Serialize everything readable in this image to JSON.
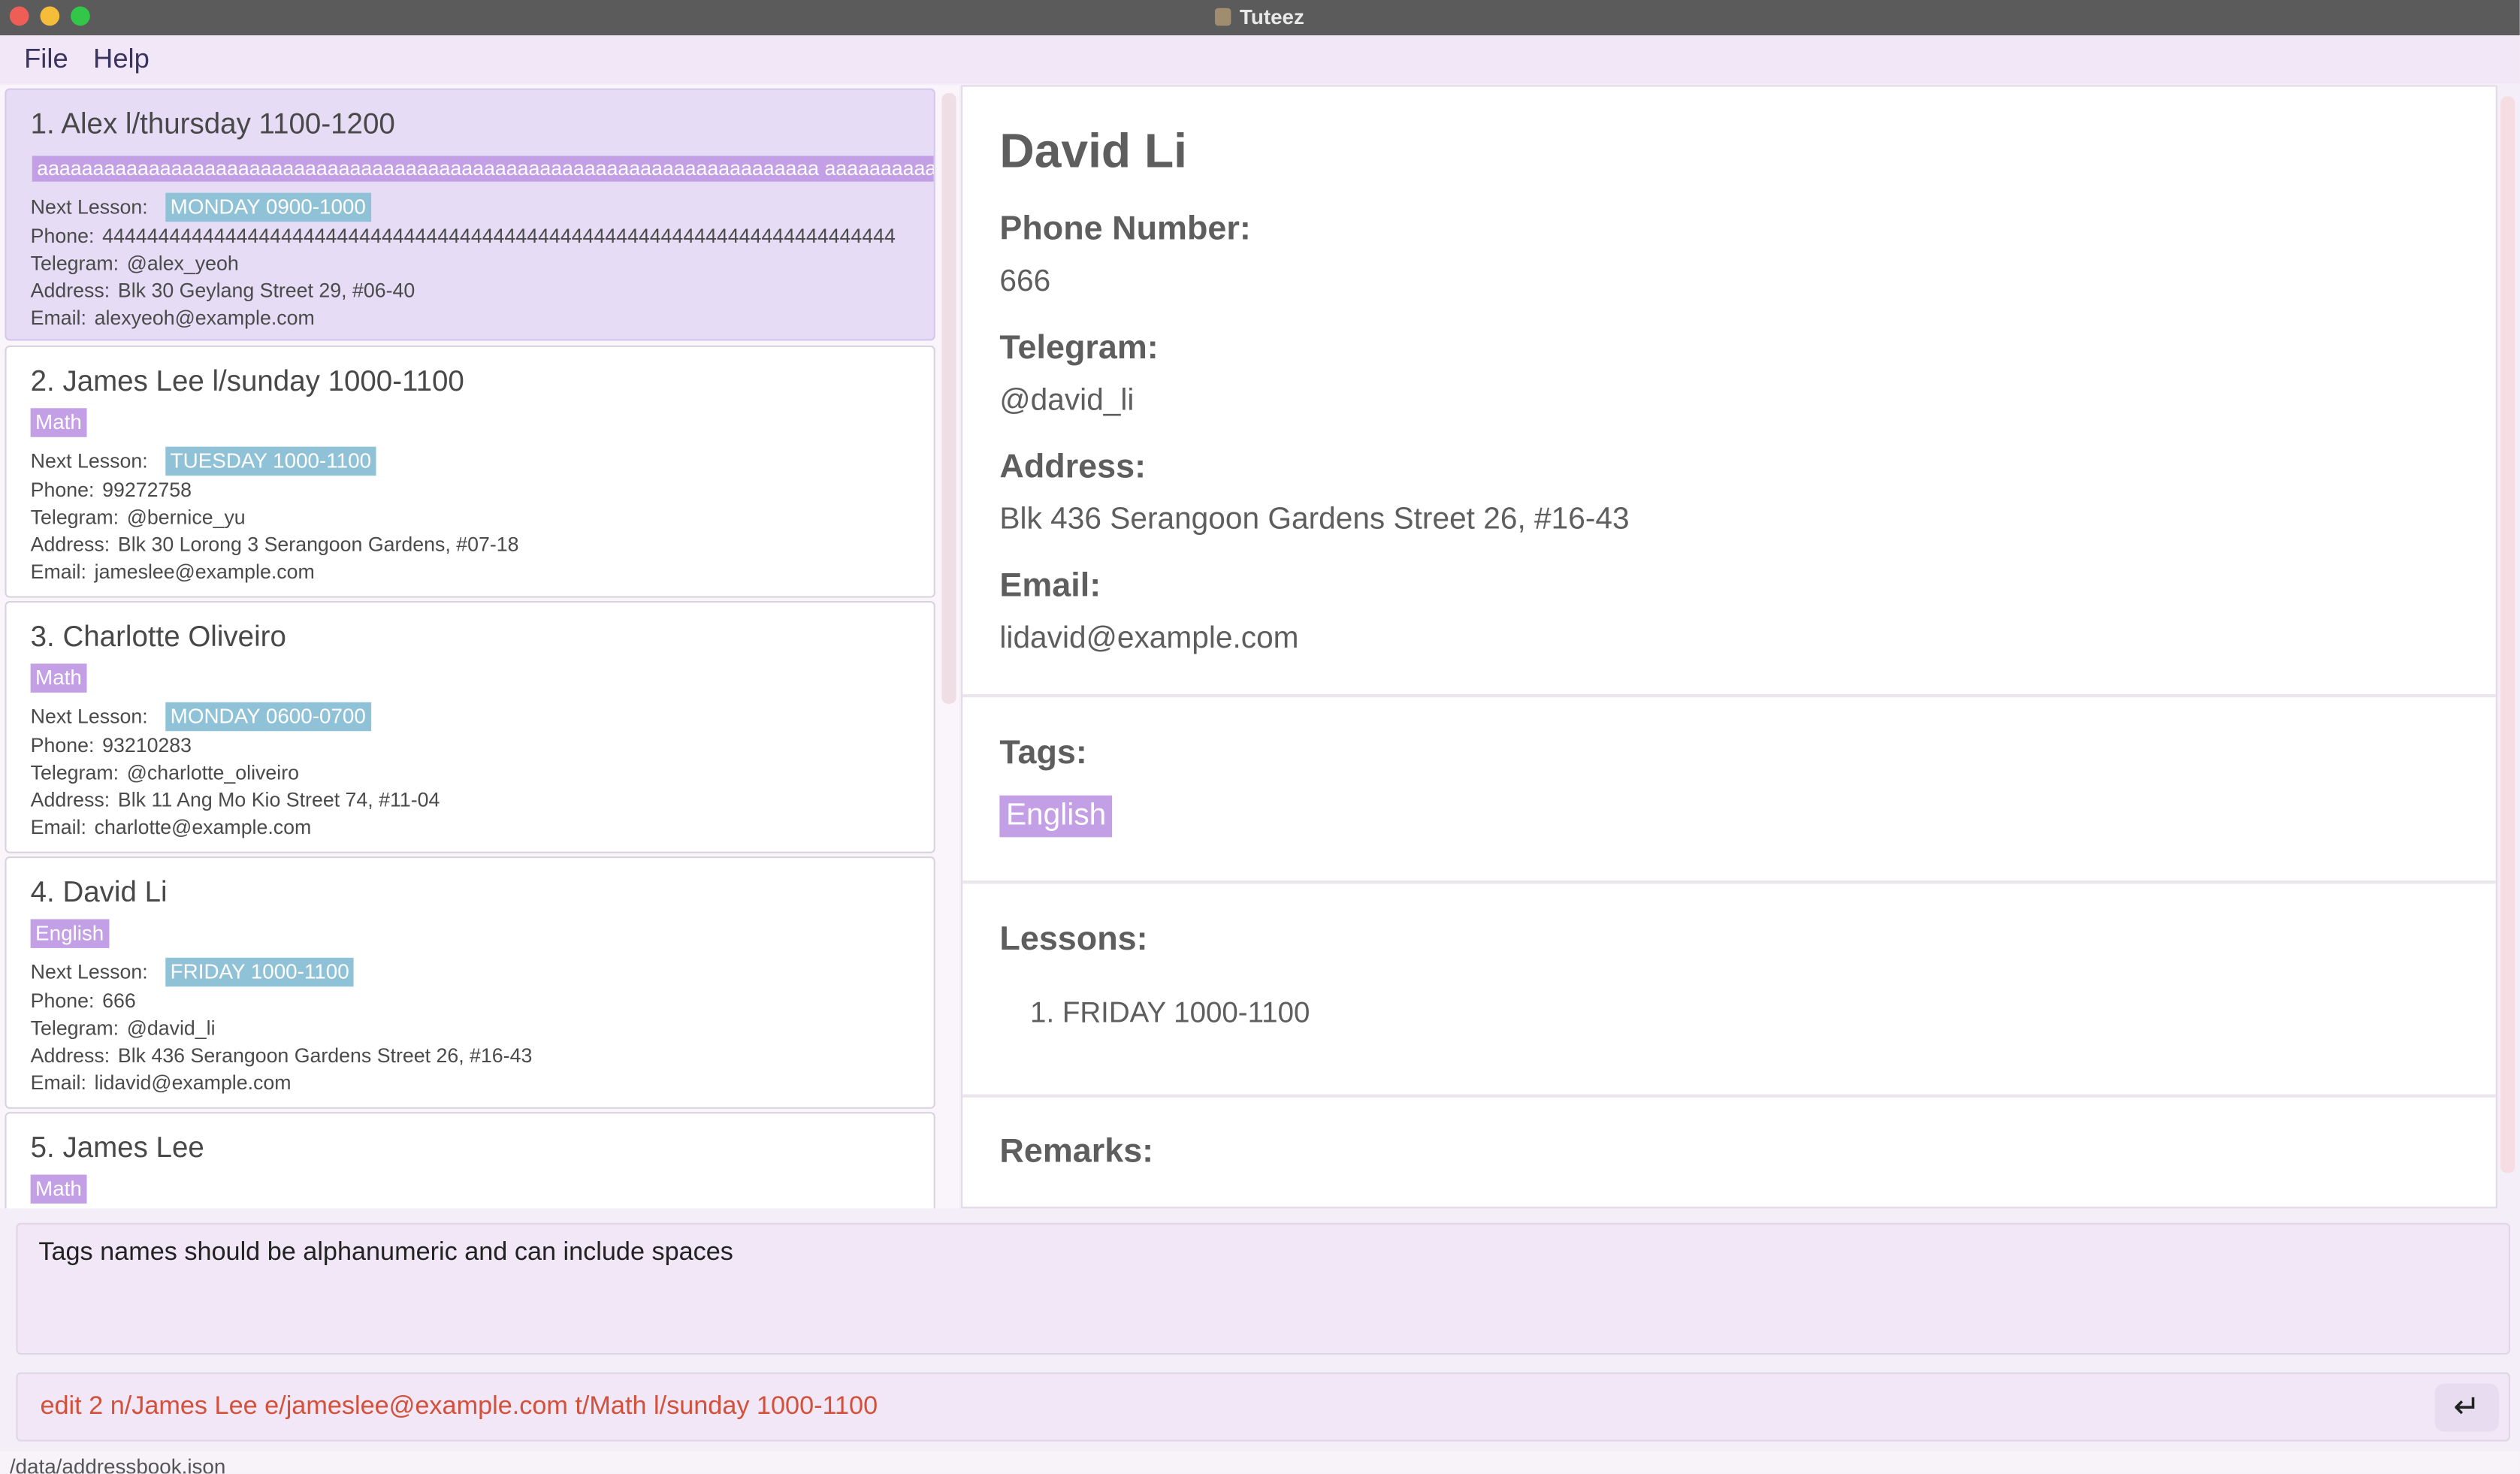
{
  "window": {
    "title": "Tuteez"
  },
  "menu": {
    "file": "File",
    "help": "Help"
  },
  "people": [
    {
      "name": "1. Alex l/thursday 1100-1200",
      "tag": "aaaaaaaaaaaaaaaaaaaaaaaaaaaaaaaaaaaaaaaaaaaaaaaaaaaaaaaaaaaaaaaaaaaaaa aaaaaaaaaaaa",
      "next_lesson_label": "Next Lesson:",
      "next_lesson": "MONDAY 0900-1000",
      "phone_label": "Phone:",
      "phone": "44444444444444444444444444444444444444444444444444444444444444444444444",
      "telegram_label": "Telegram:",
      "telegram": "@alex_yeoh",
      "address_label": "Address:",
      "address": "Blk 30 Geylang Street 29, #06-40",
      "email_label": "Email:",
      "email": "alexyeoh@example.com"
    },
    {
      "name": "2. James Lee l/sunday 1000-1100",
      "tag": "Math",
      "next_lesson_label": "Next Lesson:",
      "next_lesson": "TUESDAY 1000-1100",
      "phone_label": "Phone:",
      "phone": "99272758",
      "telegram_label": "Telegram:",
      "telegram": "@bernice_yu",
      "address_label": "Address:",
      "address": "Blk 30 Lorong 3 Serangoon Gardens, #07-18",
      "email_label": "Email:",
      "email": "jameslee@example.com"
    },
    {
      "name": "3. Charlotte Oliveiro",
      "tag": "Math",
      "next_lesson_label": "Next Lesson:",
      "next_lesson": "MONDAY 0600-0700",
      "phone_label": "Phone:",
      "phone": "93210283",
      "telegram_label": "Telegram:",
      "telegram": "@charlotte_oliveiro",
      "address_label": "Address:",
      "address": "Blk 11 Ang Mo Kio Street 74, #11-04",
      "email_label": "Email:",
      "email": "charlotte@example.com"
    },
    {
      "name": "4. David Li",
      "tag": "English",
      "next_lesson_label": "Next Lesson:",
      "next_lesson": "FRIDAY 1000-1100",
      "phone_label": "Phone:",
      "phone": "666",
      "telegram_label": "Telegram:",
      "telegram": "@david_li",
      "address_label": "Address:",
      "address": "Blk 436 Serangoon Gardens Street 26, #16-43",
      "email_label": "Email:",
      "email": "lidavid@example.com"
    },
    {
      "name": "5. James Lee",
      "tag": "Math"
    }
  ],
  "detail": {
    "name": "David Li",
    "phone_label": "Phone Number:",
    "phone": "666",
    "telegram_label": "Telegram:",
    "telegram": "@david_li",
    "address_label": "Address:",
    "address": "Blk 436 Serangoon Gardens Street 26, #16-43",
    "email_label": "Email:",
    "email": "lidavid@example.com",
    "tags_label": "Tags:",
    "tag": "English",
    "lessons_label": "Lessons:",
    "lesson_1": "1. FRIDAY 1000-1100",
    "remarks_label": "Remarks:"
  },
  "result": {
    "message": "Tags names should be alphanumeric and can include spaces"
  },
  "command": {
    "text": "edit 2 n/James Lee e/jameslee@example.com t/Math l/sunday 1000-1100",
    "enter_glyph": "↵"
  },
  "status": {
    "path": "/data/addressbook.json"
  }
}
